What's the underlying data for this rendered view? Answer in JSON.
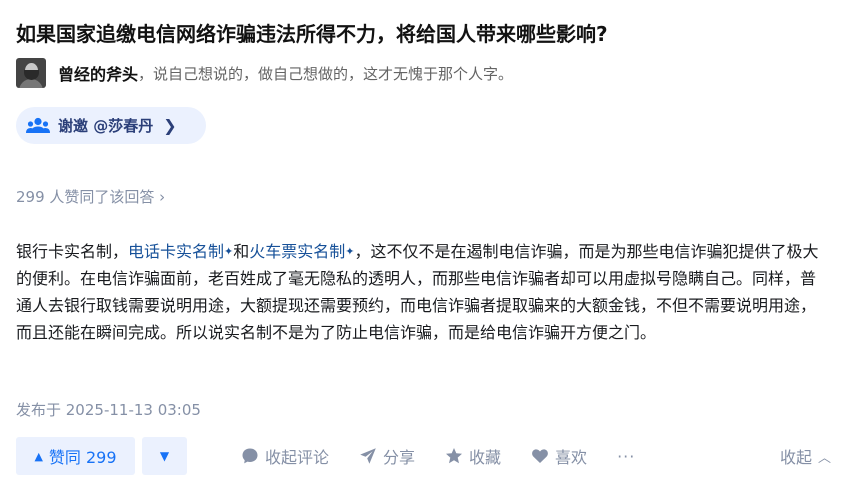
{
  "question": {
    "title": "如果国家追缴电信网络诈骗违法所得不力，将给国人带来哪些影响?"
  },
  "author": {
    "name": "曾经的斧头",
    "bio": "，说自己想说的，做自己想做的，这才无愧于那个人字。"
  },
  "invite": {
    "label": "谢邀 @莎春丹",
    "chevron": "❯"
  },
  "likes_text": "299 人赞同了该回答 ›",
  "content": {
    "seg1": "银行卡实名制，",
    "link1": "电话卡实名制",
    "and": "和",
    "link2": "火车票实名制",
    "seg2": "，这不仅不是在遏制电信诈骗，而是为那些电信诈骗犯提供了极大的便利。在电信诈骗面前，老百姓成了毫无隐私的透明人，而那些电信诈骗者却可以用虚拟号隐瞒自己。同样，普通人去银行取钱需要说明用途，大额提现还需要预约，而电信诈骗者提取骗来的大额金钱，不但不需要说明用途，而且还能在瞬间完成。所以说实名制不是为了防止电信诈骗，而是给电信诈骗开方便之门。",
    "sparkle": "✦"
  },
  "publish": "发布于 2025-11-13 03:05",
  "actions": {
    "upvote_icon": "▲",
    "upvote_label": "赞同 299",
    "downvote_icon": "▼",
    "comment": "收起评论",
    "share": "分享",
    "favorite": "收藏",
    "like": "喜欢",
    "more": "···",
    "collapse": "收起",
    "collapse_icon": "︿"
  },
  "colors": {
    "accent": "#1772f6",
    "link": "#175199",
    "muted": "#8590a6",
    "invite_bg": "#ebf1fe",
    "invite_text": "#2b3f79"
  }
}
